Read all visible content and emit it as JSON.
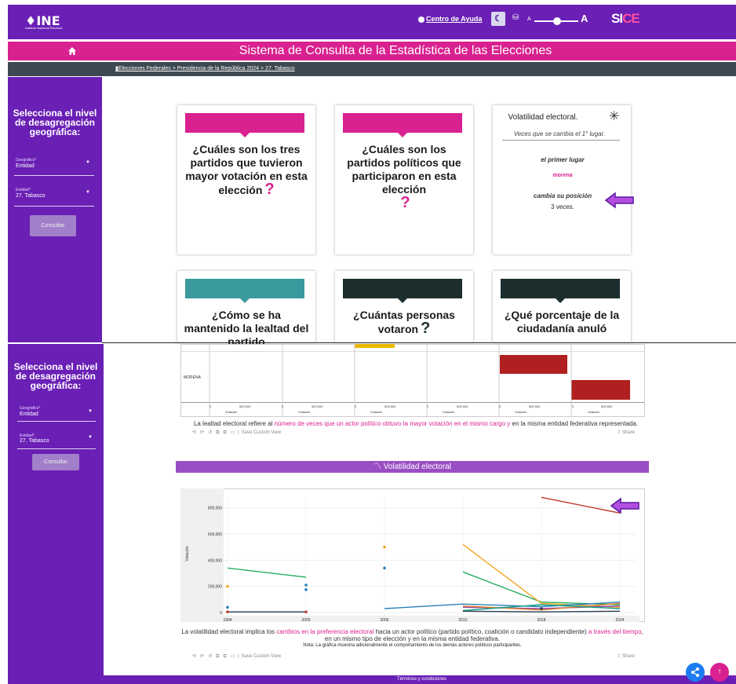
{
  "header": {
    "logo": "INE",
    "logo_sub": "Instituto Nacional Electoral",
    "help_label": "Centro de Ayuda",
    "font_small": "A",
    "font_large": "A",
    "brand_prefix": "SI",
    "brand_suffix": "CE"
  },
  "title_bar": {
    "title": "Sistema de Consulta de la Estadística de las Elecciones"
  },
  "breadcrumb": {
    "text": "Elecciones Federales > Presidencia de la República  2024 > 27. Tabasco"
  },
  "sidebar": {
    "heading": "Selecciona el nivel de desagregación geográfica:",
    "geo_label": "Geográfico*",
    "geo_value": "Entidad",
    "entity_label": "Entidad*",
    "entity_value": "27. Tabasco",
    "consult_button": "Consultar"
  },
  "cards": [
    {
      "text": "¿Cuáles son los tres partidos que tuvieron mayor votación en esta elección",
      "color": "#d9218f"
    },
    {
      "text": "¿Cuáles son los partidos políticos que participaron en esta elección",
      "color": "#d9218f"
    },
    {
      "text": "¿Cómo se ha mantenido la lealtad del partido",
      "color": "#3a9a9e"
    },
    {
      "text": "¿Cuántas personas votaron",
      "color": "#1d2e2e"
    },
    {
      "text": "¿Qué porcentaje de la ciudadanía anuló",
      "color": "#1d2e2e"
    }
  ],
  "volatility_card": {
    "title": "Volatilidad electoral.",
    "subtitle": "Veces que se cambia el 1° lugar.",
    "first": "el primer lugar",
    "party": "morena",
    "change": "cambia su posición",
    "times": "3 veces."
  },
  "bar_chart": {
    "row_label": "MORENA",
    "tick_labels": [
      "0",
      "500,000"
    ],
    "axis_label": "Votación",
    "colors": {
      "top": "#e8b800",
      "bar": "#b02020"
    }
  },
  "loyalty_caption": {
    "pre": "La lealtad electoral refiere al ",
    "highlight": "número de veces que un actor político obtuvo la mayor votación en el mismo cargo y",
    "post": "  en la misma entidad federativa representada."
  },
  "toolbar": {
    "save_view": "Save Custom View",
    "share": "Share"
  },
  "volatility_section": {
    "header": "Volatilidad electoral"
  },
  "chart_data": {
    "type": "line",
    "xlabel": "",
    "ylabel": "Votación",
    "x": [
      1994,
      2000,
      2006,
      2012,
      2018,
      2024
    ],
    "y_ticks": [
      "0",
      "200,000",
      "400,000",
      "600,000",
      "800,000"
    ],
    "ylim": [
      0,
      900000
    ],
    "series": [
      {
        "color": "#c0392b",
        "values": [
          null,
          null,
          null,
          null,
          880000,
          760000
        ]
      },
      {
        "color": "#27ae60",
        "values": [
          340000,
          270000,
          null,
          310000,
          80000,
          60000
        ]
      },
      {
        "color": "#f5a623",
        "values": [
          null,
          null,
          null,
          520000,
          70000,
          40000
        ]
      },
      {
        "color": "#2980b9",
        "values": [
          null,
          null,
          30000,
          65000,
          45000,
          80000
        ]
      },
      {
        "color": "#8e44ad",
        "values": [
          null,
          null,
          null,
          40000,
          30000,
          50000
        ]
      },
      {
        "color": "#e67e22",
        "values": [
          null,
          null,
          null,
          50000,
          20000,
          70000
        ]
      },
      {
        "color": "#16a085",
        "values": [
          null,
          null,
          null,
          15000,
          60000,
          30000
        ]
      },
      {
        "color": "#2c3e50",
        "values": [
          5000,
          5000,
          null,
          10000,
          5000,
          10000
        ]
      }
    ],
    "points": [
      {
        "x": 1994,
        "y": 200000,
        "color": "#f5a623"
      },
      {
        "x": 1994,
        "y": 40000,
        "color": "#2980b9"
      },
      {
        "x": 1994,
        "y": 5000,
        "color": "#c0392b"
      },
      {
        "x": 2000,
        "y": 210000,
        "color": "#2980b9"
      },
      {
        "x": 2000,
        "y": 175000,
        "color": "#2980b9"
      },
      {
        "x": 2000,
        "y": 5000,
        "color": "#c0392b"
      },
      {
        "x": 2006,
        "y": 500000,
        "color": "#f5a623"
      },
      {
        "x": 2006,
        "y": 340000,
        "color": "#2980b9"
      },
      {
        "x": 2018,
        "y": 30000,
        "color": "#2c3e50"
      }
    ]
  },
  "volatility_caption": {
    "pre": "La volatilidad electoral implica los ",
    "h1": "cambios en la preferencia electoral",
    "mid": " hacia un actor político (partido político, coalición o candidato independiente) ",
    "h2": "a través del tiempo",
    "post": ", en un mismo tipo de elección y en la misma entidad federativa.",
    "note": "Nota: La gráfica muestra adicionalmente el comportamiento de los demás actores políticos participantes."
  },
  "footer": {
    "text": "Términos y condiciones"
  }
}
